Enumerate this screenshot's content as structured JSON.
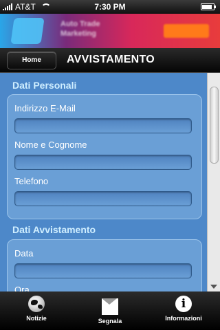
{
  "status_bar": {
    "carrier": "AT&T",
    "time": "7:30 PM",
    "signal_bars": 5,
    "battery_level": 0.9
  },
  "ad_banner": {
    "line1": "Auto Trade",
    "line2": "Marketing"
  },
  "header": {
    "home_label": "Home",
    "title": "AVVISTAMENTO"
  },
  "form": {
    "sections": [
      {
        "title": "Dati Personali",
        "fields": [
          {
            "label": "Indirizzo E-Mail",
            "value": ""
          },
          {
            "label": "Nome e Cognome",
            "value": ""
          },
          {
            "label": "Telefono",
            "value": ""
          }
        ]
      },
      {
        "title": "Dati Avvistamento",
        "fields": [
          {
            "label": "Data",
            "value": ""
          },
          {
            "label": "Ora",
            "value": ""
          }
        ]
      }
    ]
  },
  "tabbar": {
    "items": [
      {
        "label": "Notizie",
        "icon": "globe-icon"
      },
      {
        "label": "Segnala",
        "icon": "envelope-icon"
      },
      {
        "label": "Informazioni",
        "icon": "info-icon"
      }
    ]
  }
}
